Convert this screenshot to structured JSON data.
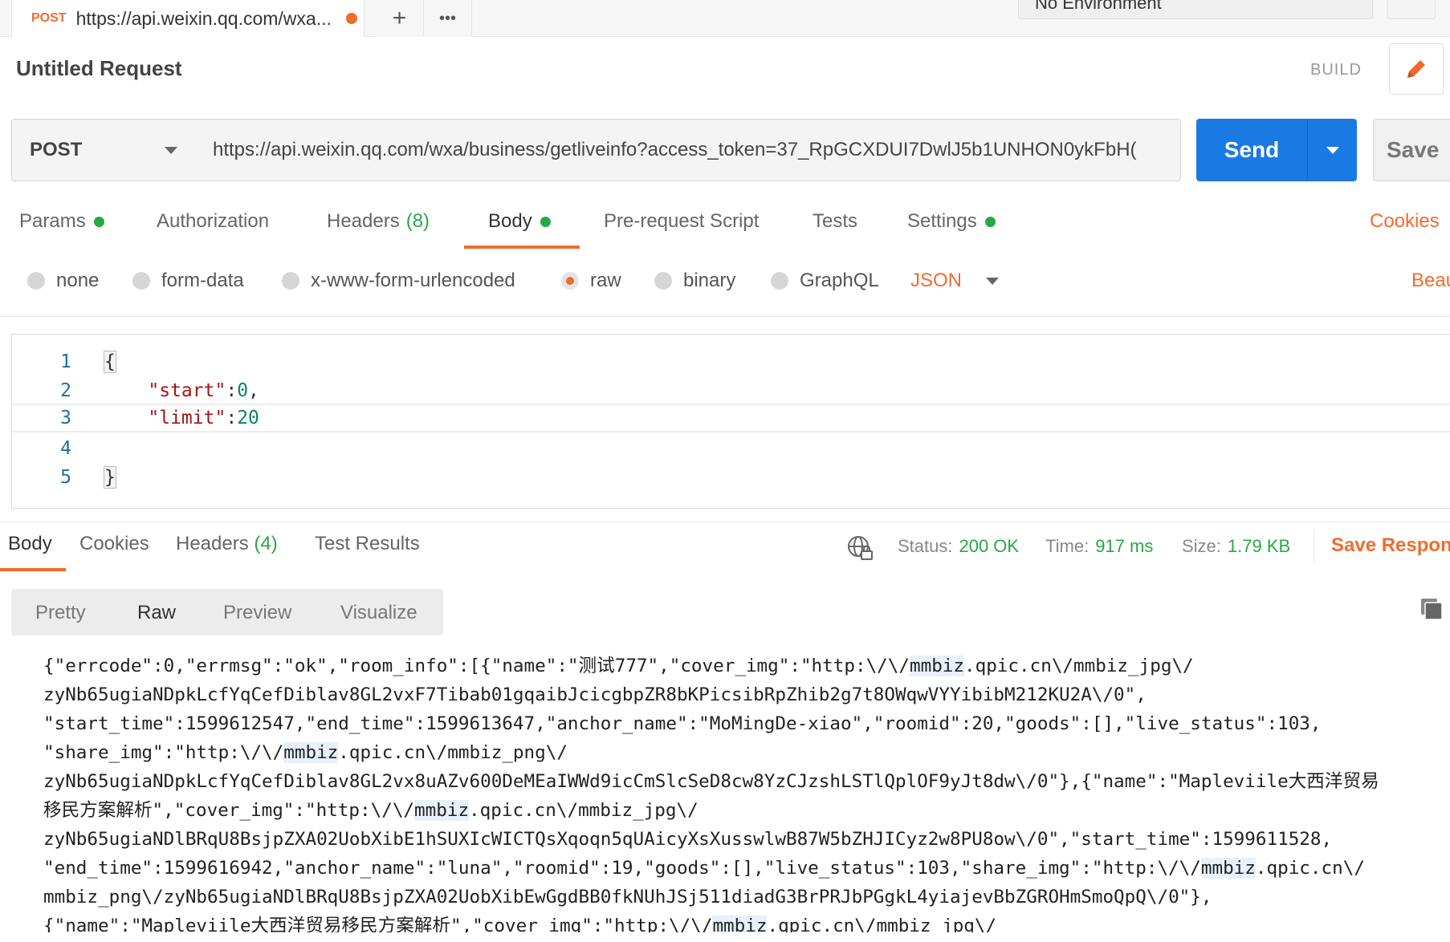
{
  "tabbar": {
    "method": "POST",
    "tab_title": "https://api.weixin.qq.com/wxa...",
    "add_label": "+",
    "more_label": "•••",
    "environment": "No Environment"
  },
  "request": {
    "title": "Untitled Request",
    "build_label": "BUILD",
    "method": "POST",
    "url": "https://api.weixin.qq.com/wxa/business/getliveinfo?access_token=37_RpGCXDUI7DwlJ5b1UNHON0ykFbH(",
    "send_label": "Send",
    "save_label": "Save"
  },
  "request_tabs": [
    {
      "label": "Params",
      "dot": true
    },
    {
      "label": "Authorization"
    },
    {
      "label": "Headers",
      "count": "(8)"
    },
    {
      "label": "Body",
      "dot": true,
      "active": true
    },
    {
      "label": "Pre-request Script"
    },
    {
      "label": "Tests"
    },
    {
      "label": "Settings",
      "dot": true
    }
  ],
  "cookies_label": "Cookies",
  "body_types": [
    {
      "label": "none",
      "selected": false
    },
    {
      "label": "form-data",
      "selected": false
    },
    {
      "label": "x-www-form-urlencoded",
      "selected": false
    },
    {
      "label": "raw",
      "selected": true
    },
    {
      "label": "binary",
      "selected": false
    },
    {
      "label": "GraphQL",
      "selected": false
    }
  ],
  "body_format": "JSON",
  "beautify_label": "Beau",
  "editor": {
    "line_numbers": [
      "1",
      "2",
      "3",
      "4",
      "5"
    ],
    "open_brace": "{",
    "close_brace": "}",
    "key_start": "\"start\"",
    "val_start": "0",
    "key_limit": "\"limit\"",
    "val_limit": "20",
    "colon": ":",
    "comma": ","
  },
  "response": {
    "tabs": [
      {
        "label": "Body",
        "active": true
      },
      {
        "label": "Cookies"
      },
      {
        "label": "Headers",
        "count": "(4)"
      },
      {
        "label": "Test Results"
      }
    ],
    "status_label": "Status:",
    "status_value": "200 OK",
    "time_label": "Time:",
    "time_value": "917 ms",
    "size_label": "Size:",
    "size_value": "1.79 KB",
    "save_label": "Save Respon",
    "view_modes": [
      "Pretty",
      "Raw",
      "Preview",
      "Visualize"
    ],
    "active_view": "Raw",
    "lines": [
      [
        "{\"errcode\":0,\"errmsg\":\"ok\",\"room_info\":[{\"name\":\"测试777\",\"cover_img\":\"http:\\/\\/",
        "mmbiz",
        ".qpic.cn\\/mmbiz_jpg\\/"
      ],
      [
        "zyNb65ugiaNDpkLcfYqCefDiblav8GL2vxF7Tibab01gqaibJcicgbpZR8bKPicsibRpZhib2g7t8OWqwVYYibibM212KU2A\\/0\","
      ],
      [
        "\"start_time\":1599612547,\"end_time\":1599613647,\"anchor_name\":\"MoMingDe-xiao\",\"roomid\":20,\"goods\":[],\"live_status\":103,"
      ],
      [
        "\"share_img\":\"http:\\/\\/",
        "mmbiz",
        ".qpic.cn\\/mmbiz_png\\/"
      ],
      [
        "zyNb65ugiaNDpkLcfYqCefDiblav8GL2vx8uAZv600DeMEaIWWd9icCmSlcSeD8cw8YzCJzshLSTlQplOF9yJt8dw\\/0\"},{\"name\":\"Mapleviile大西洋贸易"
      ],
      [
        "移民方案解析\",\"cover_img\":\"http:\\/\\/",
        "mmbiz",
        ".qpic.cn\\/mmbiz_jpg\\/"
      ],
      [
        "zyNb65ugiaNDlBRqU8BsjpZXA02UobXibE1hSUXIcWICTQsXqoqn5qUAicyXsXusswlwB87W5bZHJICyz2w8PU8ow\\/0\",\"start_time\":1599611528,"
      ],
      [
        "\"end_time\":1599616942,\"anchor_name\":\"luna\",\"roomid\":19,\"goods\":[],\"live_status\":103,\"share_img\":\"http:\\/\\/",
        "mmbiz",
        ".qpic.cn\\/"
      ],
      [
        "mmbiz_png\\/zyNb65ugiaNDlBRqU8BsjpZXA02UobXibEwGgdBB0fkNUhJSj511diadG3BrPRJbPGgkL4yiajevBbZGROHmSmoQpQ\\/0\"},"
      ],
      [
        "{\"name\":\"Mapleviile大西洋贸易移民方案解析\",\"cover_img\":\"http:\\/\\/",
        "mmbiz",
        ".qpic.cn\\/mmbiz_jpg\\/"
      ]
    ]
  },
  "colors": {
    "accent": "#f26b2d",
    "send_blue": "#1a7ae4",
    "success_green": "#27a844"
  }
}
